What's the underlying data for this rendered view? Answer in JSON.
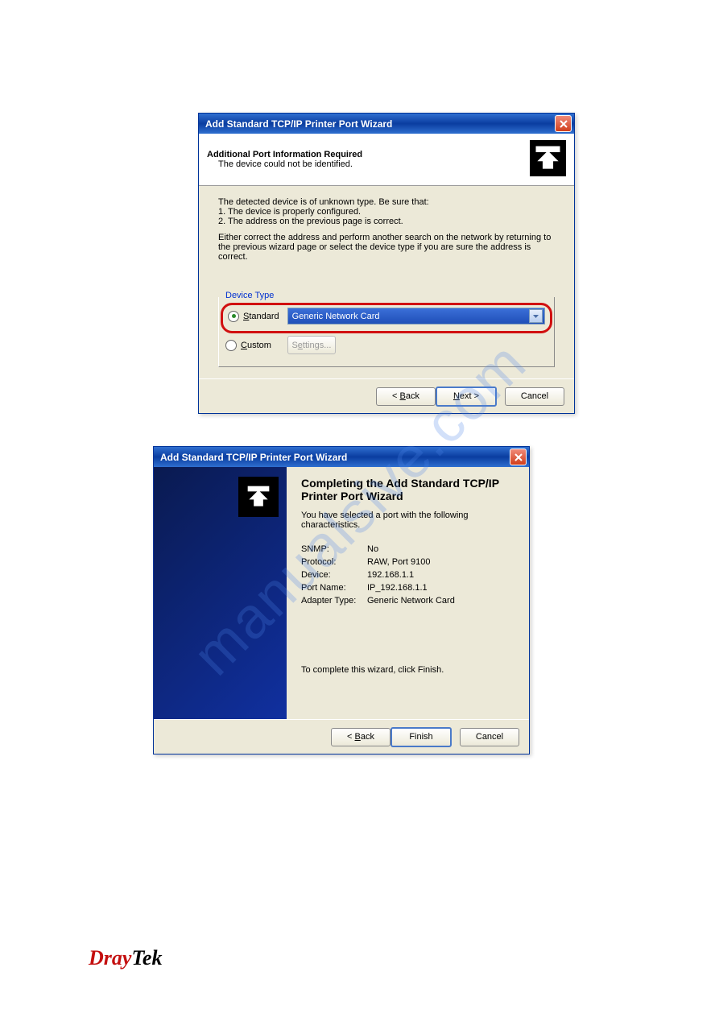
{
  "brand": {
    "red": "Dray",
    "black": "Tek"
  },
  "watermark": "manualsive.com",
  "dialog1": {
    "title": "Add Standard TCP/IP Printer Port Wizard",
    "header_title": "Additional Port Information Required",
    "header_sub": "The device could not be identified.",
    "intro": "The detected device is of unknown type. Be sure that:",
    "point1": "1. The device is properly configured.",
    "point2": "2. The address on the previous page is correct.",
    "para2": "Either correct the address and perform another search on the network by returning to the previous wizard page or select the device type if you are sure the address is correct.",
    "legend": "Device Type",
    "radio1_u": "S",
    "radio1_rest": "tandard",
    "radio2_u": "C",
    "radio2_rest": "ustom",
    "dropdown_value": "Generic Network Card",
    "settings_u": "e",
    "settings_pre": "S",
    "settings_post": "ttings...",
    "back_lt": "<",
    "back_u": "B",
    "back_rest": "ack",
    "next_u": "N",
    "next_rest": "ext >",
    "cancel": "Cancel"
  },
  "dialog2": {
    "title": "Add Standard TCP/IP Printer Port Wizard",
    "heading": "Completing the Add Standard TCP/IP Printer Port Wizard",
    "subheading": "You have selected a port with the following characteristics.",
    "rows": [
      {
        "k": "SNMP:",
        "v": "No"
      },
      {
        "k": "Protocol:",
        "v": "RAW, Port 9100"
      },
      {
        "k": "Device:",
        "v": "192.168.1.1"
      },
      {
        "k": "Port Name:",
        "v": "IP_192.168.1.1"
      },
      {
        "k": "Adapter Type:",
        "v": "Generic Network Card"
      }
    ],
    "complete_text": "To complete this wizard, click Finish.",
    "back_lt": "<",
    "back_u": "B",
    "back_rest": "ack",
    "finish": "Finish",
    "cancel": "Cancel"
  }
}
